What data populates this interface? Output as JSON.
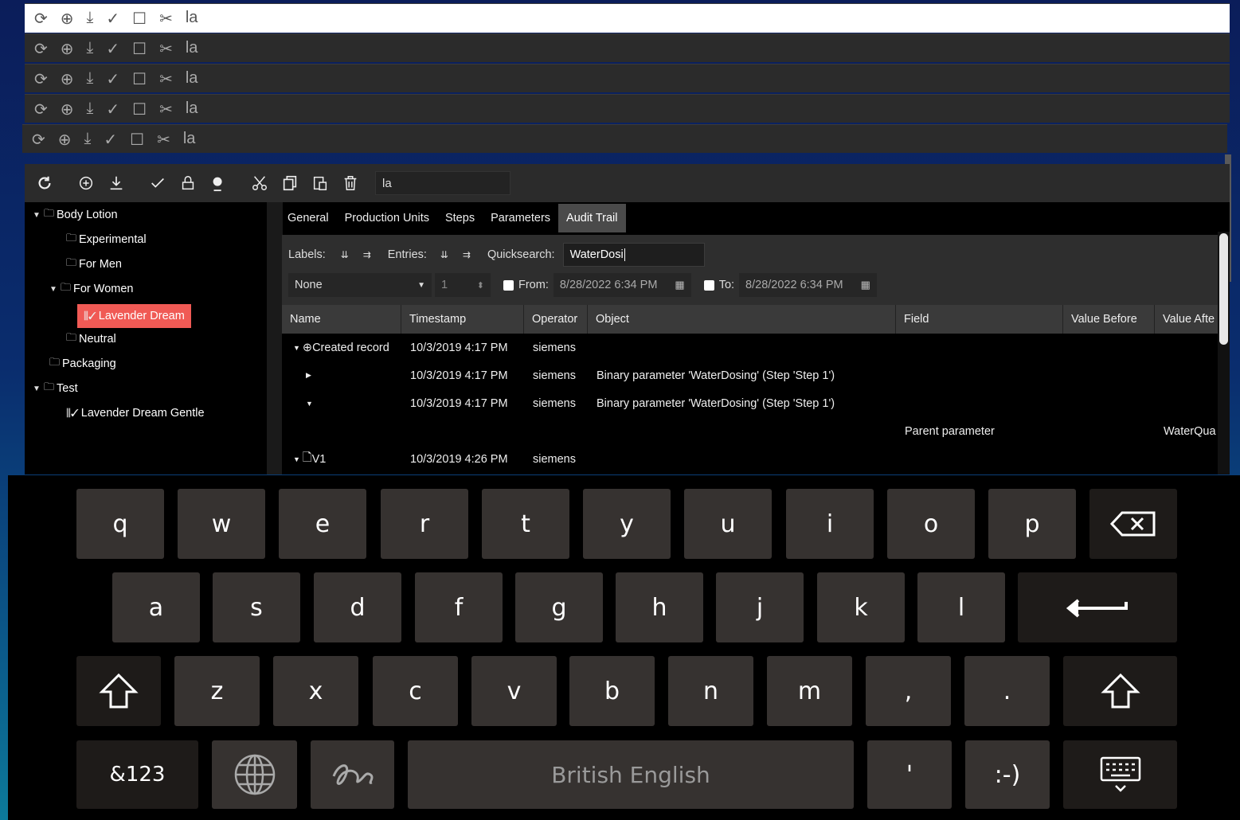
{
  "ghost_toolbar_text": "la",
  "toolbar": {
    "buttons": [
      "refresh-icon",
      "add-icon",
      "download-icon",
      "check-icon",
      "lock-icon",
      "user-icon",
      "cut-icon",
      "copy-icon",
      "paste-icon",
      "delete-icon"
    ],
    "search_value": "la"
  },
  "tree": {
    "items": [
      {
        "label": "Body Lotion",
        "expanded": true
      },
      {
        "label": "Experimental"
      },
      {
        "label": "For Men"
      },
      {
        "label": "For Women",
        "expanded": true
      },
      {
        "label": "Lavender Dream",
        "selected": true
      },
      {
        "label": "Neutral"
      },
      {
        "label": "Packaging"
      },
      {
        "label": "Test",
        "expanded": true
      },
      {
        "label": "Lavender Dream Gentle"
      }
    ]
  },
  "tabs": [
    "General",
    "Production Units",
    "Steps",
    "Parameters",
    "Audit Trail"
  ],
  "active_tab": "Audit Trail",
  "filter": {
    "labels_label": "Labels:",
    "entries_label": "Entries:",
    "quicksearch_label": "Quicksearch:",
    "quicksearch_value": "WaterDosi",
    "select_value": "None",
    "spin_value": "1",
    "from_label": "From:",
    "from_value": "8/28/2022 6:34 PM",
    "to_label": "To:",
    "to_value": "8/28/2022 6:34 PM"
  },
  "grid": {
    "columns": [
      "Name",
      "Timestamp",
      "Operator",
      "Object",
      "Field",
      "Value Before",
      "Value Afte"
    ],
    "rows": [
      {
        "name": "Created record",
        "timestamp": "10/3/2019 4:17 PM",
        "operator": "siemens",
        "object": "",
        "field": "",
        "value_after": ""
      },
      {
        "name": "",
        "timestamp": "10/3/2019 4:17 PM",
        "operator": "siemens",
        "object": "Binary parameter 'WaterDosing' (Step 'Step 1')",
        "field": "",
        "value_after": ""
      },
      {
        "name": "",
        "timestamp": "10/3/2019 4:17 PM",
        "operator": "siemens",
        "object": "Binary parameter 'WaterDosing' (Step 'Step 1')",
        "field": "",
        "value_after": ""
      },
      {
        "name": "",
        "timestamp": "",
        "operator": "",
        "object": "",
        "field": "Parent parameter",
        "value_after": "WaterQua"
      },
      {
        "name": "V1",
        "timestamp": "10/3/2019 4:26 PM",
        "operator": "siemens",
        "object": "",
        "field": "",
        "value_after": ""
      }
    ]
  },
  "keyboard": {
    "row1": [
      "q",
      "w",
      "e",
      "r",
      "t",
      "y",
      "u",
      "i",
      "o",
      "p"
    ],
    "row2": [
      "a",
      "s",
      "d",
      "f",
      "g",
      "h",
      "j",
      "k",
      "l"
    ],
    "row3": [
      "z",
      "x",
      "c",
      "v",
      "b",
      "n",
      "m",
      ",",
      "."
    ],
    "symbols_label": "&123",
    "space_label": "British English",
    "apostrophe": "'",
    "smiley": ":-)"
  },
  "colors": {
    "selected_tree_item": "#f05a55",
    "toolbar_bg": "#2b2b2b",
    "key_bg": "#363230"
  }
}
